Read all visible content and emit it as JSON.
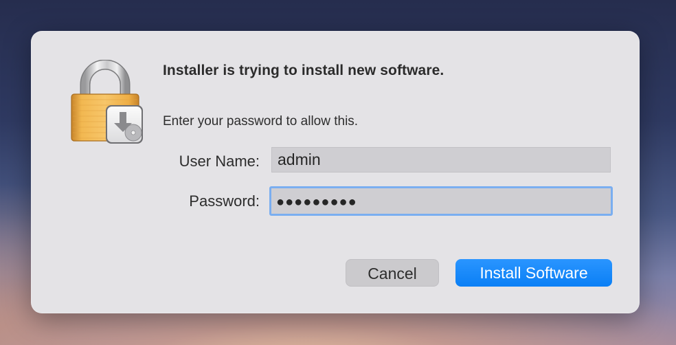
{
  "dialog": {
    "title": "Installer is trying to install new software.",
    "subtitle": "Enter your password to allow this.",
    "fields": {
      "username_label": "User Name:",
      "username_value": "admin",
      "password_label": "Password:",
      "password_value": "●●●●●●●●●"
    },
    "buttons": {
      "cancel_label": "Cancel",
      "install_label": "Install Software"
    },
    "icon": "lock-with-installer-icon"
  },
  "colors": {
    "accent": "#0a7ff5",
    "focus_ring": "#7aaef0",
    "dialog_bg": "#e4e3e6",
    "lock_gold": "#eba946"
  }
}
